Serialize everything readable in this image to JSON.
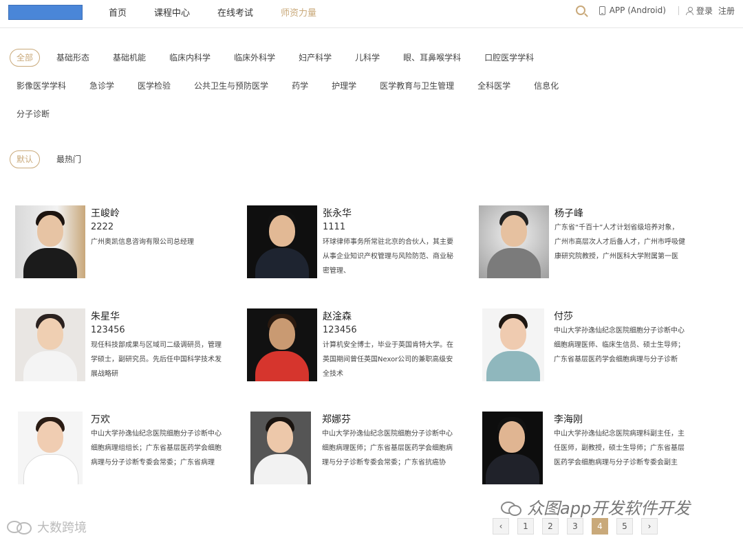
{
  "nav": {
    "items": [
      "首页",
      "课程中心",
      "在线考试",
      "师资力量"
    ],
    "active_index": 3
  },
  "header_right": {
    "app_label": "APP (Android)",
    "login": "登录",
    "register": "注册"
  },
  "filters": {
    "row1": [
      "全部",
      "基础形态",
      "基础机能",
      "临床内科学",
      "临床外科学",
      "妇产科学",
      "儿科学",
      "眼、耳鼻喉学科",
      "口腔医学学科"
    ],
    "row2": [
      "影像医学学科",
      "急诊学",
      "医学检验",
      "公共卫生与预防医学",
      "药学",
      "护理学",
      "医学教育与卫生管理",
      "全科医学",
      "信息化"
    ],
    "row3": [
      "分子诊断"
    ],
    "active": "全部"
  },
  "sort": {
    "items": [
      "默认",
      "最热门"
    ],
    "active": "默认"
  },
  "teachers": [
    {
      "name": "王峻岭",
      "sub": "2222",
      "desc": "广州奥凯信息咨询有限公司总经理"
    },
    {
      "name": "张永华",
      "sub": "1111",
      "desc": "环球律师事务所常驻北京的合伙人，其主要从事企业知识产权管理与风险防范、商业秘密管理、"
    },
    {
      "name": "杨子峰",
      "sub": "",
      "desc": "广东省“千百十”人才计划省级培养对象，广州市高层次人才后备人才，广州市呼吸健康研究院教授，广州医科大学附属第一医"
    },
    {
      "name": "朱星华",
      "sub": "123456",
      "desc": "现任科技部成果与区域司二级调研员，管理学硕士，副研究员。先后任中国科学技术发展战略研"
    },
    {
      "name": "赵淦森",
      "sub": "123456",
      "desc": "计算机安全博士，毕业于英国肯特大学。在英国期间曾任英国Nexor公司的兼职高级安全技术"
    },
    {
      "name": "付莎",
      "sub": "",
      "desc": "中山大学孙逸仙纪念医院细胞分子诊断中心细胞病理医师、临床生信员、硕士生导师；广东省基层医药学会细胞病理与分子诊断"
    },
    {
      "name": "万欢",
      "sub": "",
      "desc": "中山大学孙逸仙纪念医院细胞分子诊断中心细胞病理组组长；广东省基层医药学会细胞病理与分子诊断专委会常委；广东省病理"
    },
    {
      "name": "郑娜芬",
      "sub": "",
      "desc": "中山大学孙逸仙纪念医院细胞分子诊断中心细胞病理医师；广东省基层医药学会细胞病理与分子诊断专委会常委；广东省抗癌协"
    },
    {
      "name": "李海刚",
      "sub": "",
      "desc": "中山大学孙逸仙纪念医院病理科副主任，主任医师，副教授，硕士生导师；广东省基层医药学会细胞病理与分子诊断专委会副主"
    }
  ],
  "pagination": {
    "prev": "‹",
    "pages": [
      "1",
      "2",
      "3",
      "4",
      "5"
    ],
    "current": "4",
    "next": "›"
  },
  "watermarks": {
    "wechat": "众图app开发软件开发",
    "brand": "大数跨境"
  },
  "colors": {
    "accent": "#c9a97a",
    "logo_block": "#4a86d8"
  },
  "icons": [
    "search-icon",
    "phone-icon",
    "user-icon",
    "wechat-icon",
    "brand-icon"
  ]
}
